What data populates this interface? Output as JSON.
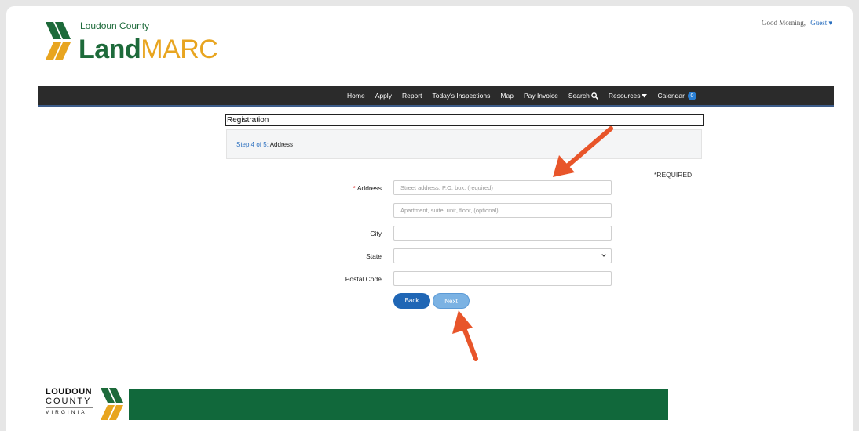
{
  "header": {
    "greeting": "Good Morning,",
    "user": "Guest",
    "logo_county": "Loudoun County",
    "logo_brand_part1": "Land",
    "logo_brand_part2": "MARC"
  },
  "nav": {
    "items": [
      {
        "label": "Home"
      },
      {
        "label": "Apply"
      },
      {
        "label": "Report"
      },
      {
        "label": "Today's Inspections"
      },
      {
        "label": "Map"
      },
      {
        "label": "Pay Invoice"
      },
      {
        "label": "Search",
        "icon": "search-icon"
      },
      {
        "label": "Resources",
        "icon": "caret-down-icon"
      },
      {
        "label": "Calendar",
        "badge": "0"
      }
    ]
  },
  "registration": {
    "title": "Registration",
    "step_label": "Step 4 of 5:",
    "step_name": "Address",
    "required_note": "*REQUIRED"
  },
  "form": {
    "address_label": "Address",
    "address_placeholder": "Street address, P.O. box. (required)",
    "address2_placeholder": "Apartment, suite, unit, floor, (optional)",
    "city_label": "City",
    "state_label": "State",
    "state_value": "",
    "postal_label": "Postal Code"
  },
  "buttons": {
    "back": "Back",
    "next": "Next"
  },
  "footer": {
    "line1": "LOUDOUN",
    "line2": "COUNTY",
    "line3": "VIRGINIA"
  },
  "colors": {
    "brand_green": "#1d6a3a",
    "brand_gold": "#e8a520",
    "nav_bg": "#2b2b2b",
    "link_blue": "#2a6fbf",
    "annotation_arrow": "#e8552a",
    "footer_green": "#11683b"
  }
}
